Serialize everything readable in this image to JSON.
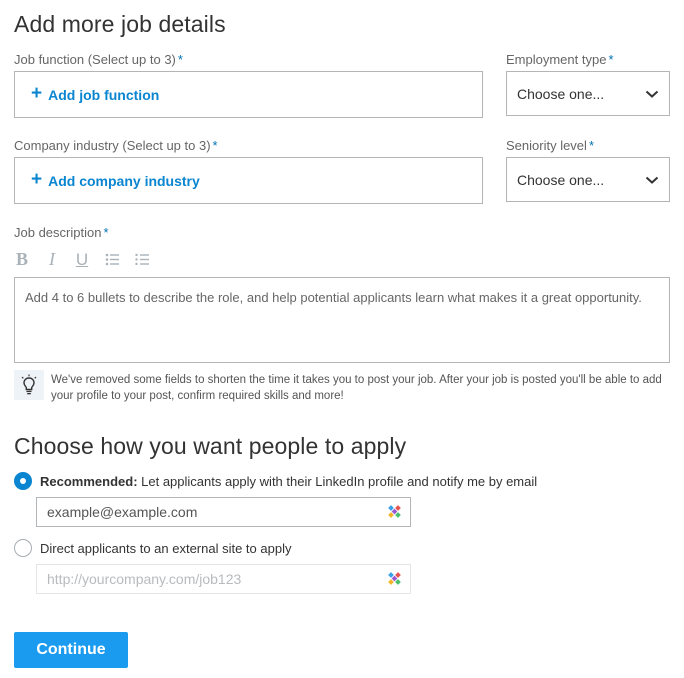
{
  "job_details": {
    "heading": "Add more job details",
    "job_function": {
      "label": "Job function (Select up to 3)",
      "required_mark": "*",
      "add_label": "Add job function"
    },
    "employment_type": {
      "label": "Employment type",
      "required_mark": "*",
      "value": "Choose one..."
    },
    "company_industry": {
      "label": "Company industry (Select up to 3)",
      "required_mark": "*",
      "add_label": "Add company industry"
    },
    "seniority_level": {
      "label": "Seniority level",
      "required_mark": "*",
      "value": "Choose one..."
    },
    "job_description": {
      "label": "Job description",
      "required_mark": "*",
      "toolbar": {
        "bold": "B",
        "italic": "I",
        "underline": "U"
      },
      "placeholder": "Add 4 to 6 bullets to describe the role, and help potential applicants learn what makes it a great opportunity."
    },
    "tip": {
      "line1": "We've removed some fields to shorten the time it takes you to post your job. After your job is posted you'll be able to add",
      "line2": "your profile to your post, confirm required skills and more!"
    }
  },
  "apply": {
    "heading": "Choose how you want people to apply",
    "option_linkedin": {
      "selected": true,
      "bold": "Recommended:",
      "text": " Let applicants apply with their LinkedIn profile and notify me by email",
      "email_value": "example@example.com"
    },
    "option_external": {
      "selected": false,
      "text": "Direct applicants to an external site to apply",
      "url_placeholder": "http://yourcompany.com/job123"
    }
  },
  "continue_label": "Continue",
  "colors": {
    "accent": "#0a85d0",
    "button": "#1a9bf0",
    "border": "#b3b6b9"
  },
  "icons": [
    "plus-icon",
    "chevron-down-icon",
    "bold-icon",
    "italic-icon",
    "underline-icon",
    "bulleted-list-icon",
    "numbered-list-icon",
    "lightbulb-icon",
    "autofill-icon"
  ]
}
